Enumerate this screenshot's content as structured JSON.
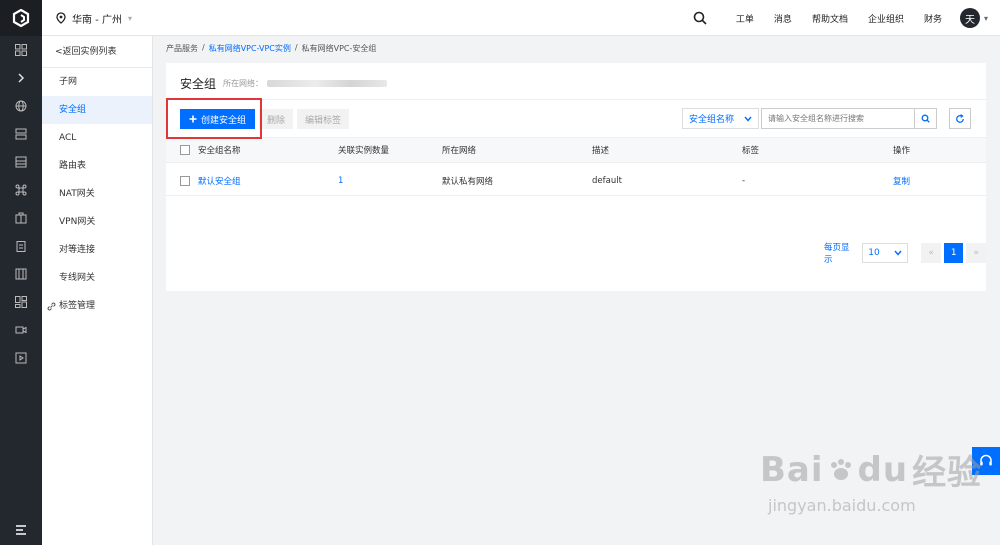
{
  "region": {
    "label": "华南 - 广州"
  },
  "topnav": {
    "items": [
      "工单",
      "消息",
      "帮助文档",
      "企业组织",
      "财务"
    ],
    "avatar": "天"
  },
  "sidebar": {
    "back": "<返回实例列表",
    "items": [
      "子网",
      "安全组",
      "ACL",
      "路由表",
      "NAT网关",
      "VPN网关",
      "对等连接",
      "专线网关",
      "标签管理"
    ],
    "active_index": 1
  },
  "breadcrumb": {
    "root": "产品服务",
    "link": "私有网络VPC-VPC实例",
    "current": "私有网络VPC-安全组",
    "sep": "/"
  },
  "page": {
    "title": "安全组",
    "vpc_label": "所在网络："
  },
  "toolbar": {
    "create": "创建安全组",
    "delete": "删除",
    "edit_tags": "编辑标签"
  },
  "filter": {
    "field": "安全组名称",
    "placeholder": "请输入安全组名称进行搜索"
  },
  "table": {
    "headers": [
      "安全组名称",
      "关联实例数量",
      "所在网络",
      "描述",
      "标签",
      "操作"
    ],
    "rows": [
      {
        "name": "默认安全组",
        "instances": "1",
        "network": "默认私有网络",
        "desc": "default",
        "tags": "-",
        "action": "复制"
      }
    ]
  },
  "pagination": {
    "per_page_label": "每页显示",
    "per_page": "10",
    "prev": "«",
    "current": "1",
    "next": "»"
  },
  "watermark": {
    "brand": "Bai",
    "brand2": "du",
    "cn": "经验",
    "url": "jingyan.baidu.com"
  },
  "colors": {
    "accent": "#006eff",
    "rail": "#23272e",
    "highlight": "#e0363a"
  }
}
